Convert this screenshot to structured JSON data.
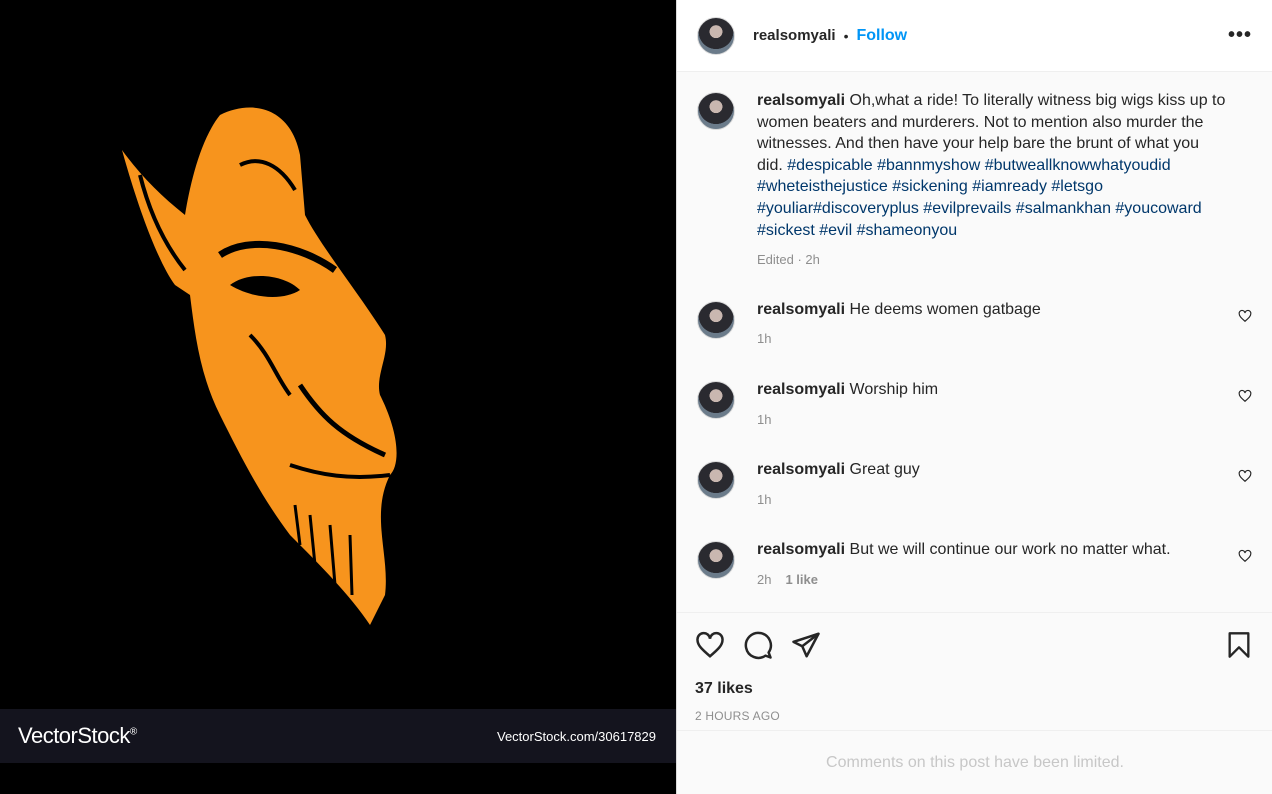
{
  "post": {
    "username": "realsomyali",
    "follow_label": "Follow",
    "separator": "•",
    "more_label": "•••"
  },
  "watermark": {
    "logo": "VectorStock",
    "logo_mark": "®",
    "url": "VectorStock.com/30617829"
  },
  "caption": {
    "username": "realsomyali",
    "text": "Oh,what a ride! To literally witness big wigs kiss up to women beaters and murderers. Not to mention also murder the witnesses. And then have your help bare the brunt of what you did.",
    "hashtags": "#despicable #bannmyshow #butweallknowwhatyoudid #wheteisthejustice #sickening #iamready #letsgo #youliar#discoveryplus #evilprevails #salmankhan #youcoward #sickest #evil #shameonyou",
    "meta": "Edited · 2h"
  },
  "comments": [
    {
      "username": "realsomyali",
      "text": "He deems women gatbage",
      "time": "1h",
      "likes": ""
    },
    {
      "username": "realsomyali",
      "text": "Worship him",
      "time": "1h",
      "likes": ""
    },
    {
      "username": "realsomyali",
      "text": "Great guy",
      "time": "1h",
      "likes": ""
    },
    {
      "username": "realsomyali",
      "text": "But we will continue our work no matter what.",
      "time": "2h",
      "likes": "1 like"
    }
  ],
  "stats": {
    "likes": "37 likes",
    "posted": "2 HOURS AGO"
  },
  "notice": "Comments on this post have been limited.",
  "colors": {
    "accent": "#0095f6",
    "hashtag": "#00376b",
    "art_orange": "#f7941d"
  }
}
